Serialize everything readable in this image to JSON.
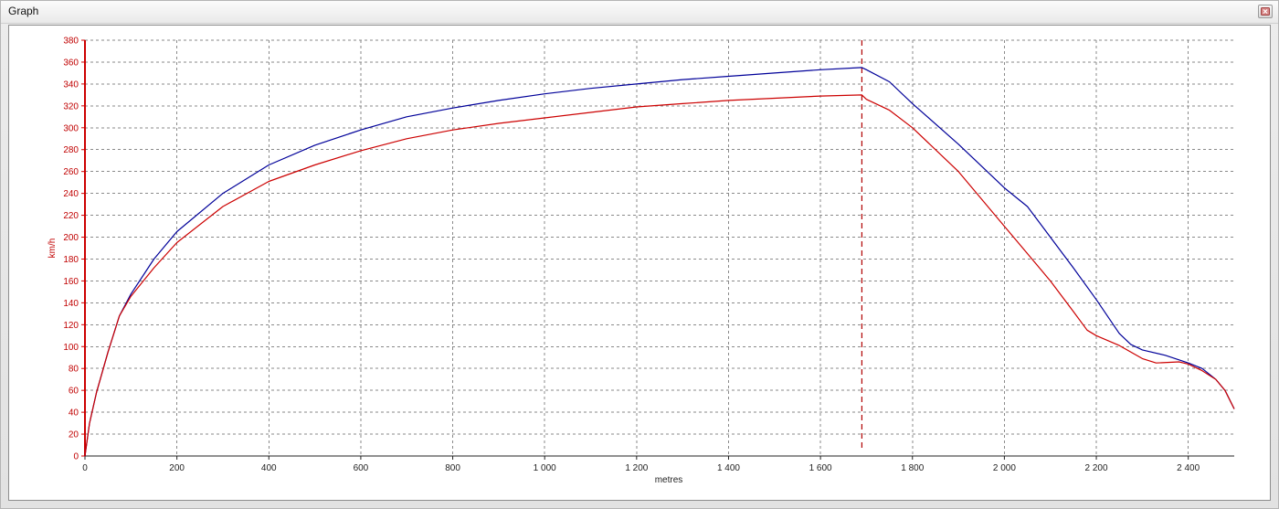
{
  "window": {
    "title": "Graph"
  },
  "chart_data": {
    "type": "line",
    "xlabel": "metres",
    "ylabel": "km/h",
    "xlim": [
      0,
      2500
    ],
    "ylim": [
      0,
      380
    ],
    "x_ticks": [
      0,
      200,
      400,
      600,
      800,
      1000,
      1200,
      1400,
      1600,
      1800,
      2000,
      2200,
      2400
    ],
    "x_tick_labels": [
      "0",
      "200",
      "400",
      "600",
      "800",
      "1 000",
      "1 200",
      "1 400",
      "1 600",
      "1 800",
      "2 000",
      "2 200",
      "2 400"
    ],
    "y_ticks": [
      0,
      20,
      40,
      60,
      80,
      100,
      120,
      140,
      160,
      180,
      200,
      220,
      240,
      260,
      280,
      300,
      320,
      340,
      360,
      380
    ],
    "grid": true,
    "marker_x": 1690,
    "colors": {
      "y_axis": "#cc0000",
      "series_blue": "#000099",
      "series_red": "#cc0000",
      "marker": "#b00000",
      "grid": "#8a8a8a"
    },
    "series": [
      {
        "color": "#000099",
        "points": [
          [
            0,
            0
          ],
          [
            10,
            30
          ],
          [
            25,
            58
          ],
          [
            50,
            95
          ],
          [
            75,
            128
          ],
          [
            100,
            148
          ],
          [
            150,
            180
          ],
          [
            200,
            205
          ],
          [
            300,
            240
          ],
          [
            400,
            266
          ],
          [
            500,
            284
          ],
          [
            600,
            298
          ],
          [
            700,
            310
          ],
          [
            800,
            318
          ],
          [
            900,
            325
          ],
          [
            1000,
            331
          ],
          [
            1100,
            336
          ],
          [
            1200,
            340
          ],
          [
            1300,
            344
          ],
          [
            1400,
            347
          ],
          [
            1500,
            350
          ],
          [
            1600,
            353
          ],
          [
            1690,
            355
          ],
          [
            1700,
            353
          ],
          [
            1750,
            342
          ],
          [
            1800,
            322
          ],
          [
            1900,
            285
          ],
          [
            2000,
            245
          ],
          [
            2050,
            228
          ],
          [
            2100,
            200
          ],
          [
            2150,
            172
          ],
          [
            2200,
            143
          ],
          [
            2250,
            112
          ],
          [
            2275,
            102
          ],
          [
            2300,
            97
          ],
          [
            2350,
            92
          ],
          [
            2400,
            85
          ],
          [
            2430,
            80
          ],
          [
            2460,
            70
          ],
          [
            2480,
            60
          ],
          [
            2500,
            43
          ]
        ]
      },
      {
        "color": "#cc0000",
        "points": [
          [
            0,
            0
          ],
          [
            10,
            30
          ],
          [
            25,
            58
          ],
          [
            50,
            95
          ],
          [
            75,
            128
          ],
          [
            100,
            146
          ],
          [
            150,
            172
          ],
          [
            200,
            195
          ],
          [
            300,
            228
          ],
          [
            400,
            251
          ],
          [
            500,
            266
          ],
          [
            600,
            279
          ],
          [
            700,
            290
          ],
          [
            800,
            298
          ],
          [
            900,
            304
          ],
          [
            1000,
            309
          ],
          [
            1100,
            314
          ],
          [
            1200,
            319
          ],
          [
            1300,
            322
          ],
          [
            1400,
            325
          ],
          [
            1500,
            327
          ],
          [
            1600,
            329
          ],
          [
            1690,
            330
          ],
          [
            1700,
            326
          ],
          [
            1750,
            316
          ],
          [
            1800,
            300
          ],
          [
            1900,
            260
          ],
          [
            2000,
            210
          ],
          [
            2050,
            185
          ],
          [
            2100,
            160
          ],
          [
            2150,
            132
          ],
          [
            2180,
            115
          ],
          [
            2200,
            110
          ],
          [
            2250,
            101
          ],
          [
            2300,
            89
          ],
          [
            2330,
            85
          ],
          [
            2380,
            86
          ],
          [
            2400,
            84
          ],
          [
            2430,
            78
          ],
          [
            2460,
            70
          ],
          [
            2480,
            60
          ],
          [
            2500,
            43
          ]
        ]
      }
    ]
  }
}
